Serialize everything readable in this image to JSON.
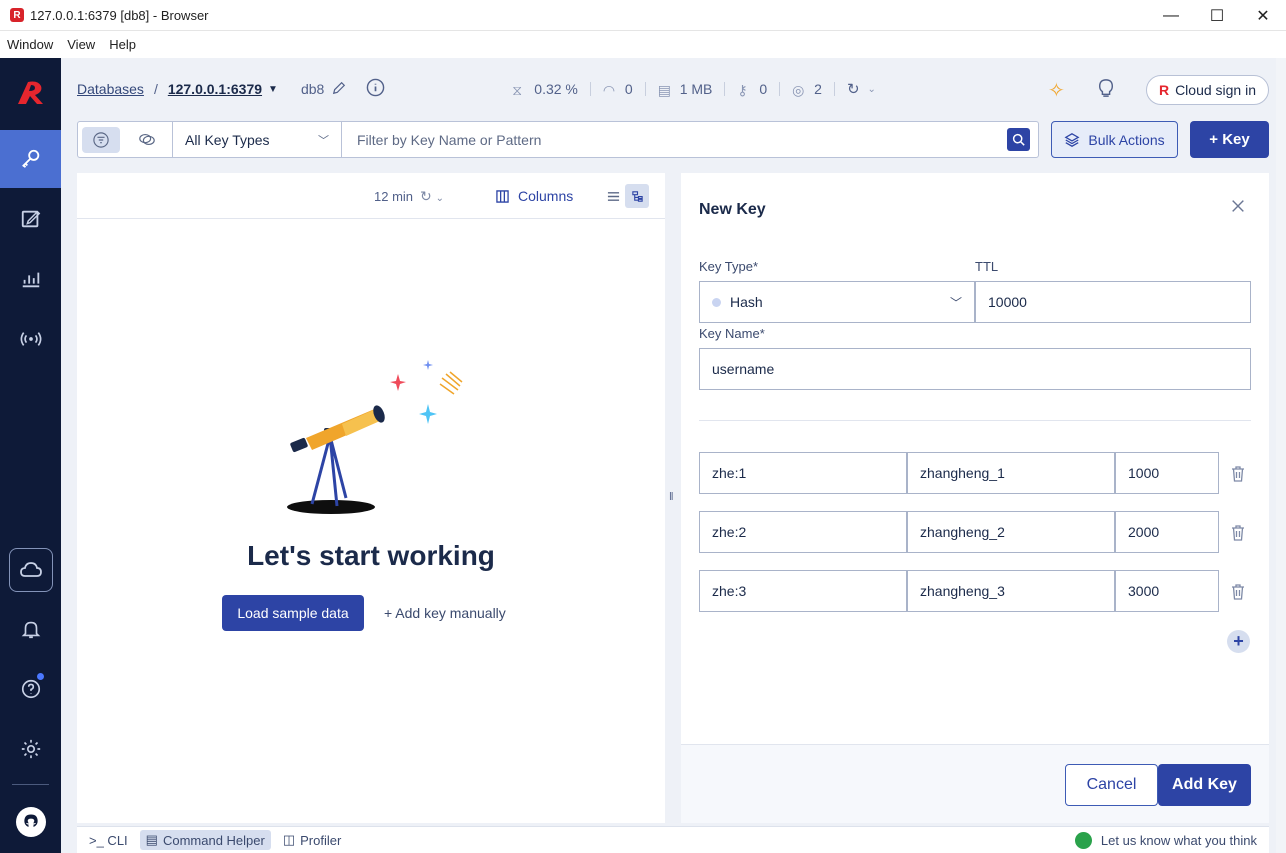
{
  "window": {
    "title": "127.0.0.1:6379 [db8] - Browser",
    "min": "—",
    "max": "☐",
    "close": "✕"
  },
  "menu": [
    "Window",
    "View",
    "Help"
  ],
  "header": {
    "databases": "Databases",
    "separator": "/",
    "host": "127.0.0.1:6379",
    "db": "db8",
    "stats": {
      "cpu": "0.32 %",
      "ops": "0",
      "memory": "1 MB",
      "keys": "0",
      "clients": "2"
    },
    "cloud_sign_in": "Cloud sign in"
  },
  "filter": {
    "key_type": "All Key Types",
    "placeholder": "Filter by Key Name or Pattern",
    "bulk_actions": "Bulk Actions",
    "add_key": "+ Key"
  },
  "list_panel": {
    "time": "12 min",
    "columns": "Columns",
    "empty_title": "Let's start working",
    "load_sample": "Load sample data",
    "add_manually": "+ Add key manually"
  },
  "new_key": {
    "title": "New Key",
    "key_type_label": "Key Type*",
    "key_type_value": "Hash",
    "ttl_label": "TTL",
    "ttl_value": "10000",
    "key_name_label": "Key Name*",
    "key_name_value": "username",
    "fields": [
      {
        "field": "zhe:1",
        "value": "zhangheng_1",
        "ttl": "1000"
      },
      {
        "field": "zhe:2",
        "value": "zhangheng_2",
        "ttl": "2000"
      },
      {
        "field": "zhe:3",
        "value": "zhangheng_3",
        "ttl": "3000"
      }
    ],
    "cancel": "Cancel",
    "submit": "Add Key"
  },
  "bottom": {
    "cli": ">_ CLI",
    "command_helper": "Command Helper",
    "profiler": "Profiler",
    "feedback": "Let us know what you think"
  },
  "colors": {
    "primary": "#2d44a5",
    "nav_bg": "#0e1a38",
    "nav_active": "#4b6fd1",
    "brand": "#e5262e"
  }
}
